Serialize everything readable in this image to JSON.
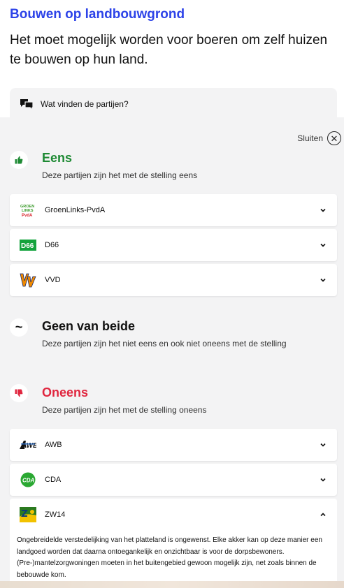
{
  "statement": {
    "title": "Bouwen op landbouwgrond",
    "text": "Het moet mogelijk worden voor boeren om zelf huizen te bouwen op hun land."
  },
  "parties_toggle": {
    "label": "Wat vinden de partijen?",
    "icon": "chat-bubbles-icon"
  },
  "panel": {
    "close_label": "Sluiten",
    "groups": [
      {
        "key": "eens",
        "title": "Eens",
        "description": "Deze partijen zijn het met de stelling eens",
        "color": "#1e8a34",
        "icon": "thumbs-up-icon",
        "parties": [
          {
            "name": "GroenLinks-PvdA",
            "logo": "groenlinks-pvda-logo"
          },
          {
            "name": "D66",
            "logo": "d66-logo"
          },
          {
            "name": "VVD",
            "logo": "vvd-logo"
          }
        ]
      },
      {
        "key": "geen",
        "title": "Geen van beide",
        "description": "Deze partijen zijn het niet eens en ook niet oneens met de stelling",
        "color": "#111111",
        "icon": "tilde-icon",
        "parties": []
      },
      {
        "key": "oneens",
        "title": "Oneens",
        "description": "Deze partijen zijn het met de stelling oneens",
        "color": "#e0263f",
        "icon": "thumbs-down-icon",
        "parties": [
          {
            "name": "AWB",
            "logo": "awb-logo"
          },
          {
            "name": "CDA",
            "logo": "cda-logo"
          },
          {
            "name": "ZW14",
            "logo": "zw14-logo",
            "expanded": true,
            "opinion": "Ongebreidelde verstedelijking van het platteland is ongewenst. Elke akker kan op deze manier een landgoed worden dat daarna ontoegankelijk en onzichtbaar is voor de dorpsbewoners. (Pre-)mantelzorgwoningen moeten in het buitengebied gewoon mogelijk zijn, net zoals binnen de bebouwde kom."
          }
        ]
      }
    ]
  },
  "colors": {
    "accent": "#2d43e8",
    "panel_bg": "#f3f3f4"
  }
}
